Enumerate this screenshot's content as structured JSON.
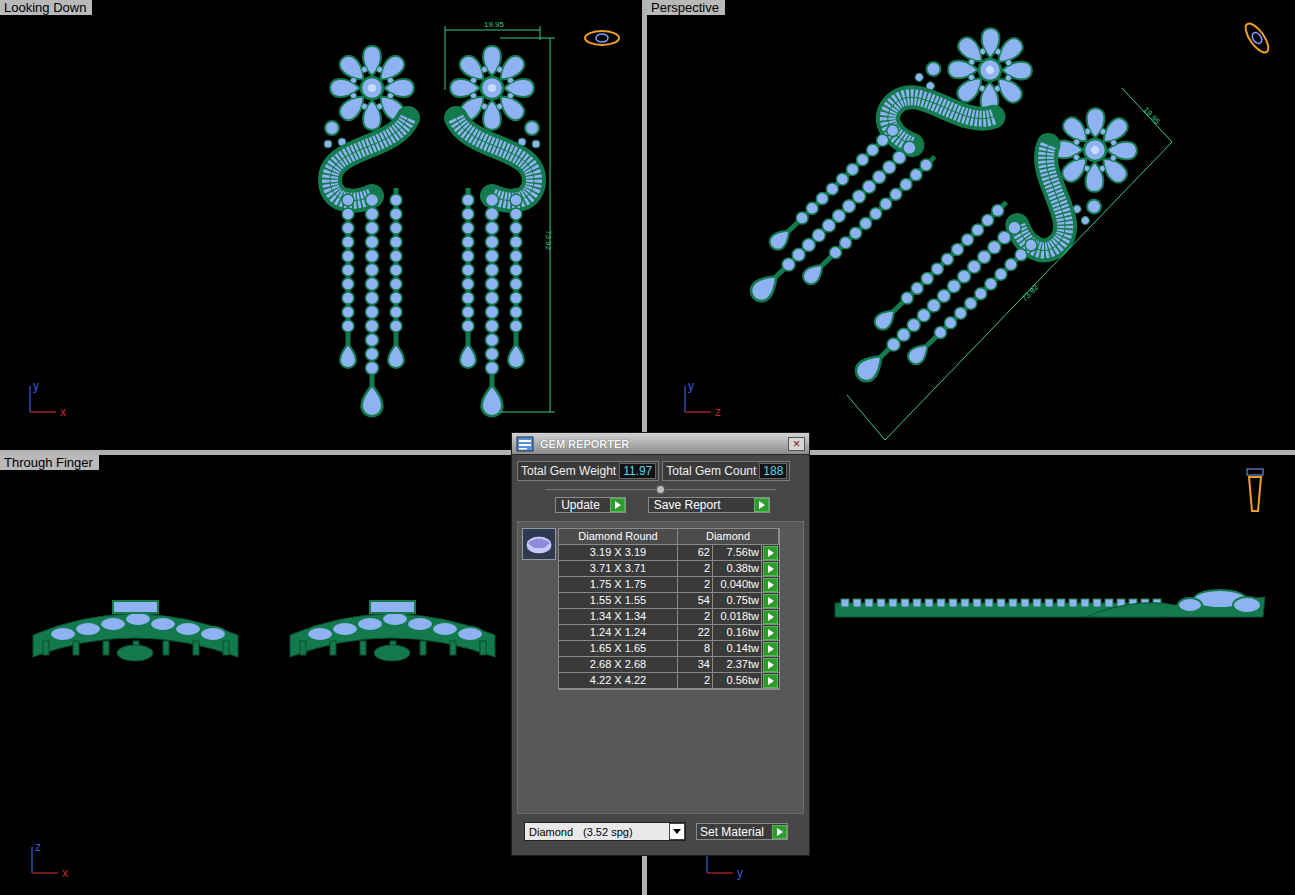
{
  "viewports": [
    {
      "kind": "top",
      "label": "Looking Down",
      "axes": {
        "vertical": "y",
        "horizontal": "x"
      },
      "dimensions": [
        "19.95",
        "73.92"
      ]
    },
    {
      "kind": "perspective",
      "label": "Perspective",
      "axes": {
        "vertical": "y",
        "horizontal": "z"
      },
      "dimensions": [
        "19.95",
        "73.92"
      ]
    },
    {
      "kind": "front",
      "label": "Through Finger",
      "axes": {
        "vertical": "z",
        "horizontal": "x"
      },
      "dimensions": []
    },
    {
      "kind": "side",
      "axes": {
        "horizontal": "y"
      },
      "dimensions": []
    }
  ],
  "dialog": {
    "title": "GEM REPORTER",
    "close": "×",
    "total_weight_label": "Total Gem Weight",
    "total_weight": "11.97",
    "total_count_label": "Total Gem Count",
    "total_count": "188",
    "buttons": [
      "Update",
      "Save Report"
    ],
    "table": {
      "columns": [
        "Diamond Round",
        "Diamond"
      ],
      "rows": [
        {
          "size": "3.19 X 3.19",
          "count": "62",
          "weight": "7.56tw"
        },
        {
          "size": "3.71 X 3.71",
          "count": "2",
          "weight": "0.38tw"
        },
        {
          "size": "1.75 X 1.75",
          "count": "2",
          "weight": "0.040tw"
        },
        {
          "size": "1.55 X 1.55",
          "count": "54",
          "weight": "0.75tw"
        },
        {
          "size": "1.34 X 1.34",
          "count": "2",
          "weight": "0.018tw"
        },
        {
          "size": "1.24 X 1.24",
          "count": "22",
          "weight": "0.16tw"
        },
        {
          "size": "1.65 X 1.65",
          "count": "8",
          "weight": "0.14tw"
        },
        {
          "size": "2.68 X 2.68",
          "count": "34",
          "weight": "2.37tw"
        },
        {
          "size": "4.22 X 4.22",
          "count": "2",
          "weight": "0.56tw"
        }
      ]
    },
    "material": {
      "name": "Diamond",
      "density": "(3.52 spg)"
    },
    "set_material": "Set Material"
  }
}
